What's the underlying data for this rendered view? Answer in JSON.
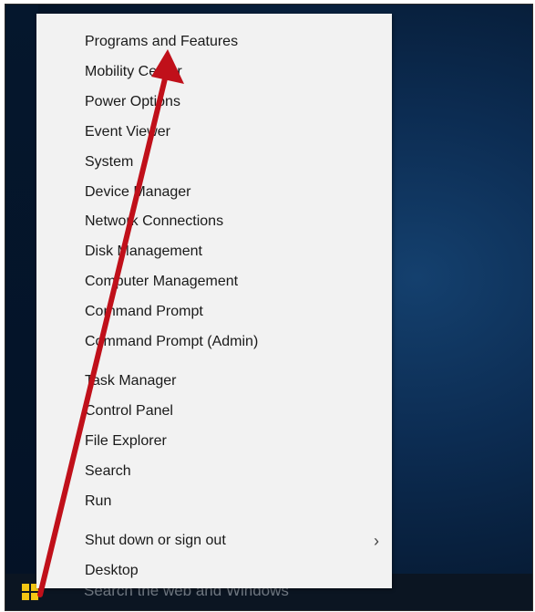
{
  "menu": {
    "items": [
      {
        "label": "Programs and Features"
      },
      {
        "label": "Mobility Center"
      },
      {
        "label": "Power Options"
      },
      {
        "label": "Event Viewer"
      },
      {
        "label": "System"
      },
      {
        "label": "Device Manager"
      },
      {
        "label": "Network Connections"
      },
      {
        "label": "Disk Management"
      },
      {
        "label": "Computer Management"
      },
      {
        "label": "Command Prompt"
      },
      {
        "label": "Command Prompt (Admin)"
      },
      {
        "label": "Task Manager"
      },
      {
        "label": "Control Panel"
      },
      {
        "label": "File Explorer"
      },
      {
        "label": "Search"
      },
      {
        "label": "Run"
      },
      {
        "label": "Shut down or sign out",
        "submenu_icon": "chevron-right-icon"
      },
      {
        "label": "Desktop"
      }
    ],
    "submenu_chevron": "›"
  },
  "taskbar": {
    "search_placeholder": "Search the web and Windows",
    "start_icon": "windows-logo-icon"
  },
  "annotation": {
    "arrow_color": "#c0101a"
  },
  "colors": {
    "menu_background": "#f2f2f2",
    "desktop_background": "#0c2c52",
    "start_logo": "#f3c613"
  }
}
